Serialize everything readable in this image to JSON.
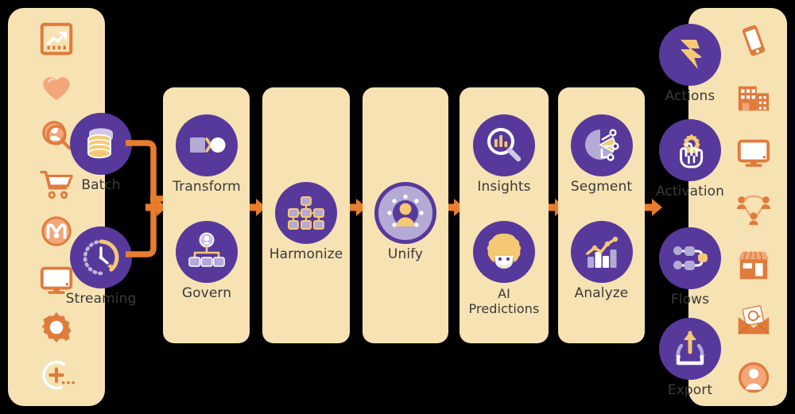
{
  "diagram": {
    "title": "Customer Data Platform Flow",
    "colors": {
      "panel_bg": "#F6E2B3",
      "node_purple": "#57399B",
      "accent_orange": "#E87D2E",
      "icon_orange": "#E07B3C",
      "icon_orange_light": "#F2A679",
      "label_text": "#3A3A3A",
      "node_icon_gold": "#F5C873",
      "node_icon_lavender": "#B3AAD6",
      "node_icon_white": "#FFFFFF",
      "background": "#000000"
    }
  },
  "sources_panel": {
    "name": "data-sources",
    "icons": [
      {
        "name": "chart-trend-icon",
        "label": "Analytics"
      },
      {
        "name": "heart-icon",
        "label": "Loyalty"
      },
      {
        "name": "person-search-icon",
        "label": "Identity"
      },
      {
        "name": "shopping-cart-icon",
        "label": "Commerce"
      },
      {
        "name": "mulesoft-icon",
        "label": "MuleSoft"
      },
      {
        "name": "desktop-monitor-icon",
        "label": "Web"
      },
      {
        "name": "gear-icon",
        "label": "Settings"
      },
      {
        "name": "plus-circle-more-icon",
        "label": "More"
      }
    ]
  },
  "ingest": {
    "nodes": [
      {
        "name": "batch-node",
        "label": "Batch",
        "icon": "database-stack-icon"
      },
      {
        "name": "streaming-node",
        "label": "Streaming",
        "icon": "clock-stream-icon"
      }
    ]
  },
  "stages": [
    {
      "name": "stage-transform-govern",
      "nodes": [
        {
          "name": "transform-node",
          "label": "Transform",
          "icon": "square-to-circle-icon"
        },
        {
          "name": "govern-node",
          "label": "Govern",
          "icon": "person-hierarchy-icon"
        }
      ]
    },
    {
      "name": "stage-harmonize",
      "nodes": [
        {
          "name": "harmonize-node",
          "label": "Harmonize",
          "icon": "node-network-icon"
        }
      ]
    },
    {
      "name": "stage-unify",
      "nodes": [
        {
          "name": "unify-node",
          "label": "Unify",
          "icon": "profile-ring-icon"
        }
      ]
    },
    {
      "name": "stage-insights-ai",
      "nodes": [
        {
          "name": "insights-node",
          "label": "Insights",
          "icon": "magnifier-bars-icon"
        },
        {
          "name": "ai-predictions-node",
          "label": "AI\nPredictions",
          "icon": "einstein-face-icon"
        }
      ]
    },
    {
      "name": "stage-segment-analyze",
      "nodes": [
        {
          "name": "segment-node",
          "label": "Segment",
          "icon": "pie-split-icon"
        },
        {
          "name": "analyze-node",
          "label": "Analyze",
          "icon": "bar-line-chart-icon"
        }
      ]
    }
  ],
  "activation": {
    "nodes": [
      {
        "name": "actions-node",
        "label": "Actions",
        "icon": "lightning-bolt-icon"
      },
      {
        "name": "activation-node",
        "label": "Activation",
        "icon": "hand-gear-icon"
      },
      {
        "name": "flows-node",
        "label": "Flows",
        "icon": "flow-nodes-icon"
      },
      {
        "name": "export-node",
        "label": "Export",
        "icon": "export-arrow-icon"
      }
    ]
  },
  "destinations_panel": {
    "name": "destinations",
    "icons": [
      {
        "name": "mobile-phone-icon",
        "label": "Mobile"
      },
      {
        "name": "office-buildings-icon",
        "label": "Enterprise"
      },
      {
        "name": "desktop-monitor-icon",
        "label": "Desktop"
      },
      {
        "name": "people-network-icon",
        "label": "Community"
      },
      {
        "name": "storefront-icon",
        "label": "Retail"
      },
      {
        "name": "email-at-icon",
        "label": "Email"
      },
      {
        "name": "user-avatar-icon",
        "label": "Profile"
      }
    ]
  },
  "flow_arrows": [
    {
      "name": "arrow-ingest-to-transform"
    },
    {
      "name": "arrow-transform-to-harmonize"
    },
    {
      "name": "arrow-harmonize-to-unify"
    },
    {
      "name": "arrow-unify-to-insights"
    },
    {
      "name": "arrow-insights-to-segment"
    },
    {
      "name": "arrow-segment-to-activation"
    }
  ],
  "connectors": [
    {
      "name": "connector-batch-streaming-merge"
    }
  ]
}
